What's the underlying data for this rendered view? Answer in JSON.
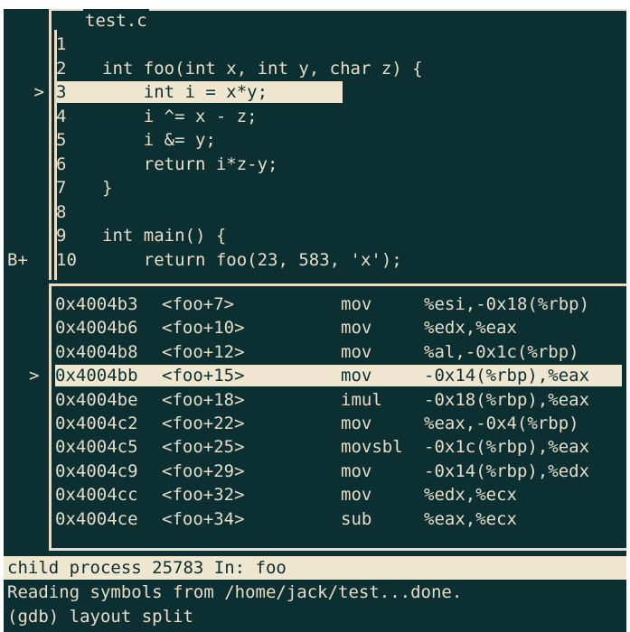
{
  "source_pane": {
    "title": "test.c",
    "lines": [
      {
        "marker": "",
        "num": "1",
        "code": ""
      },
      {
        "marker": "",
        "num": "2",
        "code": "int foo(int x, int y, char z) {"
      },
      {
        "marker": ">",
        "num": "3",
        "code": "    int i = x*y;"
      },
      {
        "marker": "",
        "num": "4",
        "code": "    i ^= x - z;"
      },
      {
        "marker": "",
        "num": "5",
        "code": "    i &= y;"
      },
      {
        "marker": "",
        "num": "6",
        "code": "    return i*z-y;"
      },
      {
        "marker": "",
        "num": "7",
        "code": "}"
      },
      {
        "marker": "",
        "num": "8",
        "code": ""
      },
      {
        "marker": "",
        "num": "9",
        "code": "int main() {"
      },
      {
        "marker": "B+",
        "num": "10",
        "code": "    return foo(23, 583, 'x');"
      }
    ]
  },
  "asm_pane": {
    "rows": [
      {
        "marker": "",
        "addr": "0x4004b3",
        "sym": "<foo+7>",
        "op": "mov",
        "args": "%esi,-0x18(%rbp)"
      },
      {
        "marker": "",
        "addr": "0x4004b6",
        "sym": "<foo+10>",
        "op": "mov",
        "args": "%edx,%eax"
      },
      {
        "marker": "",
        "addr": "0x4004b8",
        "sym": "<foo+12>",
        "op": "mov",
        "args": "%al,-0x1c(%rbp)"
      },
      {
        "marker": ">",
        "addr": "0x4004bb",
        "sym": "<foo+15>",
        "op": "mov",
        "args": "-0x14(%rbp),%eax"
      },
      {
        "marker": "",
        "addr": "0x4004be",
        "sym": "<foo+18>",
        "op": "imul",
        "args": "-0x18(%rbp),%eax"
      },
      {
        "marker": "",
        "addr": "0x4004c2",
        "sym": "<foo+22>",
        "op": "mov",
        "args": "%eax,-0x4(%rbp)"
      },
      {
        "marker": "",
        "addr": "0x4004c5",
        "sym": "<foo+25>",
        "op": "movsbl",
        "args": "-0x1c(%rbp),%eax"
      },
      {
        "marker": "",
        "addr": "0x4004c9",
        "sym": "<foo+29>",
        "op": "mov",
        "args": "-0x14(%rbp),%edx"
      },
      {
        "marker": "",
        "addr": "0x4004cc",
        "sym": "<foo+32>",
        "op": "mov",
        "args": "%edx,%ecx"
      },
      {
        "marker": "",
        "addr": "0x4004ce",
        "sym": "<foo+34>",
        "op": "sub",
        "args": "%eax,%ecx"
      }
    ]
  },
  "status_bar": {
    "text": "child process 25783 In: foo"
  },
  "command_area": {
    "lines": [
      "Reading symbols from /home/jack/test...done.",
      "(gdb) layout split"
    ]
  },
  "colors": {
    "background": "#0c2f31",
    "foreground": "#e6dcc8",
    "highlight": "#efe6d0"
  }
}
